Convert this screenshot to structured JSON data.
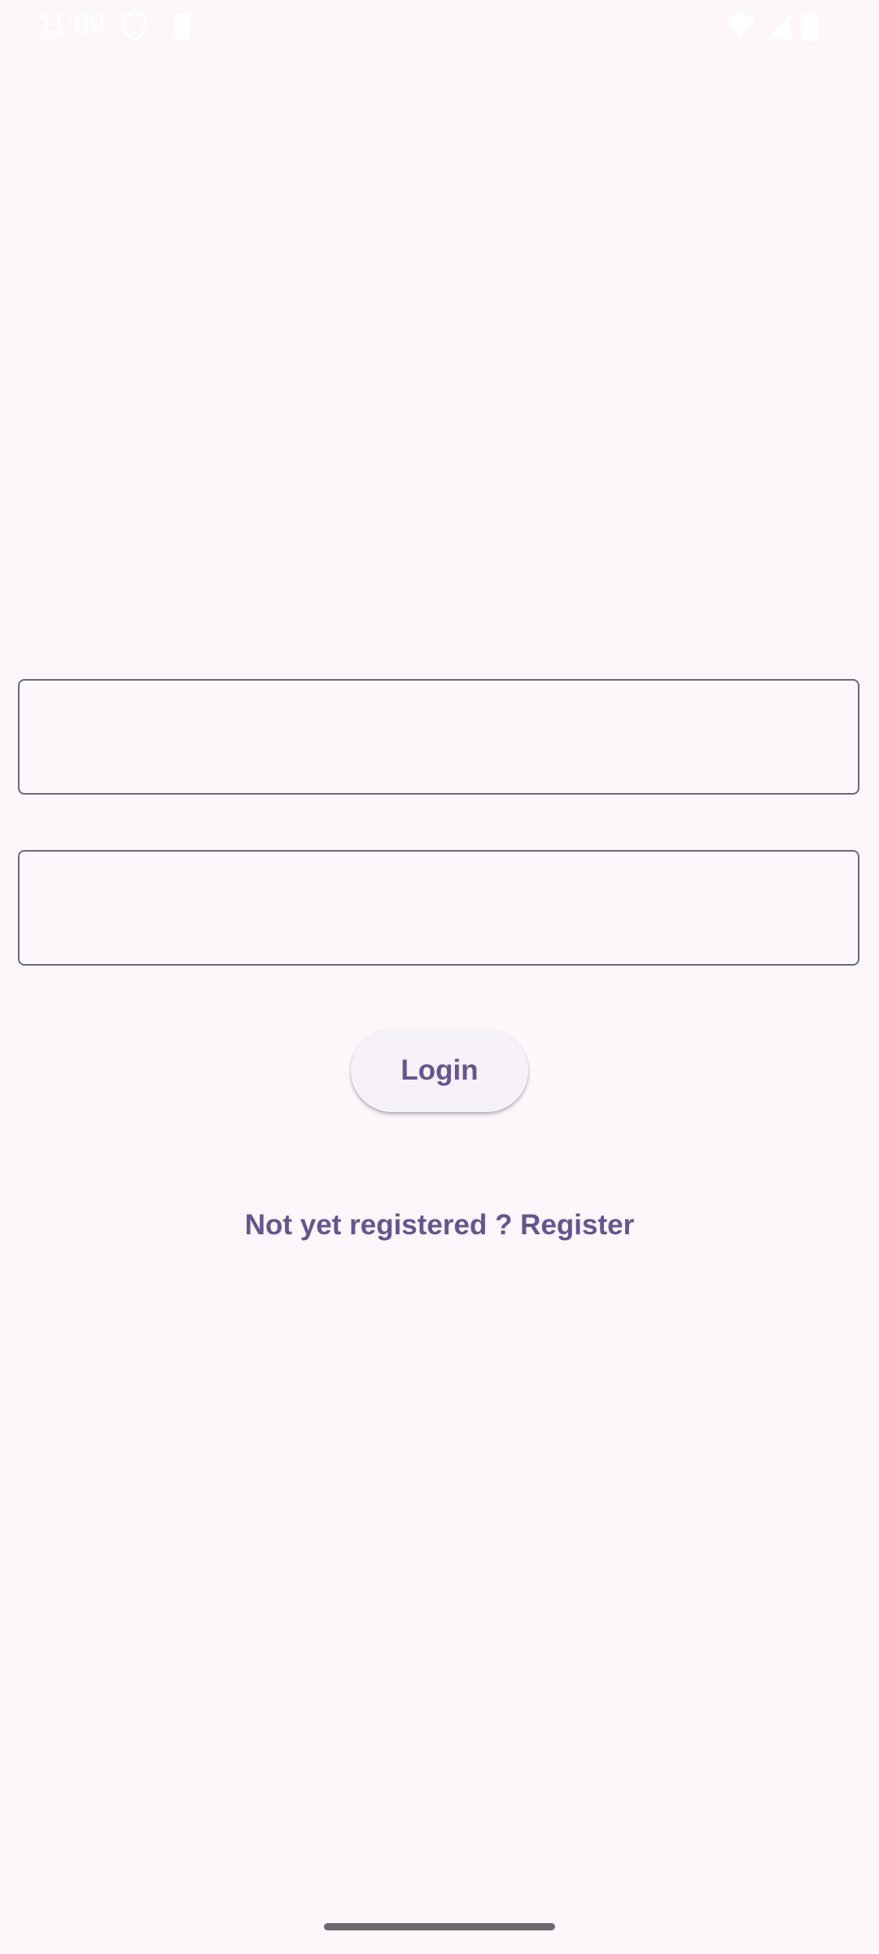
{
  "status_bar": {
    "time": "11:09",
    "icons": [
      "vpn-shield-icon",
      "sd-card-icon",
      "wifi-icon",
      "cellular-signal-icon",
      "battery-icon"
    ]
  },
  "form": {
    "username": {
      "value": "",
      "placeholder": ""
    },
    "password": {
      "value": "",
      "placeholder": ""
    },
    "login_label": "Login",
    "register_prompt": "Not yet registered ? Register"
  },
  "colors": {
    "background": "#fdf7fc",
    "primary": "#65558f",
    "outline": "#6f6b72",
    "button_surface": "#f6f1f7"
  }
}
